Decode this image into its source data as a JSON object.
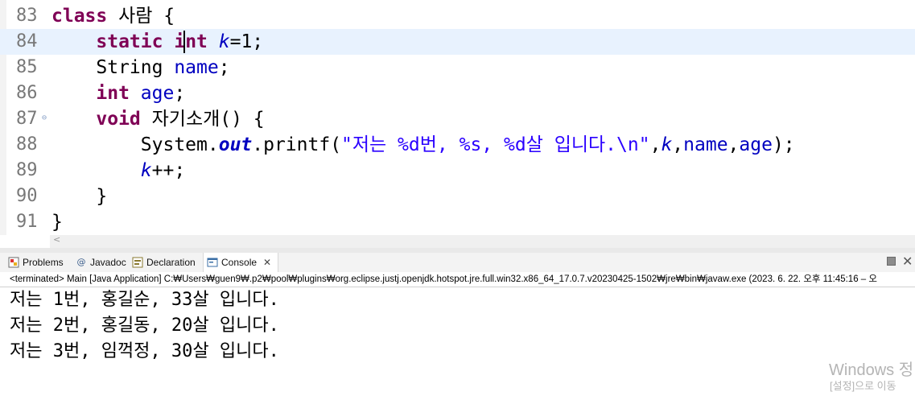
{
  "editor": {
    "lines": [
      {
        "num": "83",
        "parts": [
          [
            "kw",
            "class"
          ],
          [
            "",
            " 사람 {"
          ]
        ]
      },
      {
        "num": "84",
        "parts": [
          [
            "",
            "    "
          ],
          [
            "kw",
            "static"
          ],
          [
            "",
            " "
          ],
          [
            "kw",
            "int"
          ],
          [
            "",
            " "
          ],
          [
            "sv",
            "k"
          ],
          [
            "",
            "=1;"
          ]
        ]
      },
      {
        "num": "85",
        "parts": [
          [
            "",
            "    String "
          ],
          [
            "fld",
            "name"
          ],
          [
            "",
            ";"
          ]
        ]
      },
      {
        "num": "86",
        "parts": [
          [
            "",
            "    "
          ],
          [
            "kw",
            "int"
          ],
          [
            "",
            " "
          ],
          [
            "fld",
            "age"
          ],
          [
            "",
            ";"
          ]
        ]
      },
      {
        "num": "87",
        "parts": [
          [
            "",
            "    "
          ],
          [
            "kw",
            "void"
          ],
          [
            "",
            " 자기소개() {"
          ]
        ]
      },
      {
        "num": "88",
        "parts": [
          [
            "",
            "        System."
          ],
          [
            "sfld",
            "out"
          ],
          [
            "",
            ".printf("
          ],
          [
            "str",
            "\"저는 %d번, %s, %d살 입니다.\\n\""
          ],
          [
            "",
            ","
          ],
          [
            "sv",
            "k"
          ],
          [
            "",
            ","
          ],
          [
            "fld",
            "name"
          ],
          [
            "",
            ","
          ],
          [
            "fld",
            "age"
          ],
          [
            "",
            ");"
          ]
        ]
      },
      {
        "num": "89",
        "parts": [
          [
            "",
            "        "
          ],
          [
            "sv",
            "k"
          ],
          [
            "",
            "++;"
          ]
        ]
      },
      {
        "num": "90",
        "parts": [
          [
            "",
            "    }"
          ]
        ]
      },
      {
        "num": "91",
        "parts": [
          [
            "",
            "}"
          ]
        ]
      }
    ],
    "hscroll_left": "<"
  },
  "console_view": {
    "tabs": [
      {
        "label": "Problems",
        "icon": "problems-icon"
      },
      {
        "label": "Javadoc",
        "icon": "javadoc-icon"
      },
      {
        "label": "Declaration",
        "icon": "declaration-icon"
      },
      {
        "label": "Console",
        "icon": "console-icon",
        "close": "✕"
      }
    ],
    "launch_info": "<terminated> Main [Java Application] C:₩Users₩guen9₩.p2₩pool₩plugins₩org.eclipse.justj.openjdk.hotspot.jre.full.win32.x86_64_17.0.7.v20230425-1502₩jre₩bin₩javaw.exe  (2023. 6. 22. 오후 11:45:16 – 오",
    "output": [
      "저는 1번, 홍길순, 33살 입니다.",
      "저는 2번, 홍길동, 20살 입니다.",
      "저는 3번, 임꺽정, 30살 입니다."
    ]
  },
  "watermark": {
    "line1": "Windows 정",
    "line2": "[설정]으로 이동"
  },
  "colors": {
    "keyword": "#7f0055",
    "field": "#0000c0",
    "string": "#2a00ff",
    "current_line": "#e8f2fe"
  }
}
